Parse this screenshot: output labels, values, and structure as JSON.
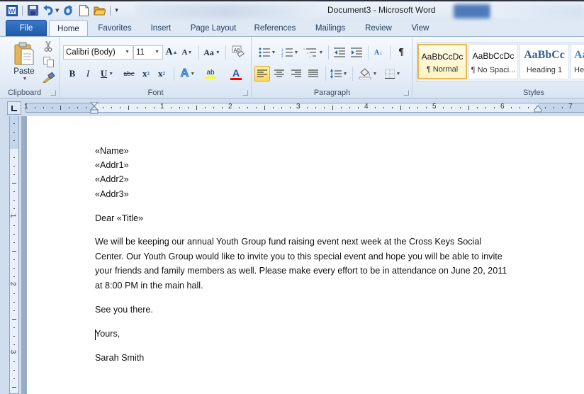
{
  "window": {
    "title": "Document3  -  Microsoft Word"
  },
  "quick_access": {
    "icons": [
      "word-logo-icon",
      "save-icon",
      "undo-icon",
      "redo-icon",
      "new-document-icon",
      "open-folder-icon",
      "customize-qat-icon"
    ]
  },
  "tabs": [
    {
      "label": "File"
    },
    {
      "label": "Home"
    },
    {
      "label": "Favorites"
    },
    {
      "label": "Insert"
    },
    {
      "label": "Page Layout"
    },
    {
      "label": "References"
    },
    {
      "label": "Mailings"
    },
    {
      "label": "Review"
    },
    {
      "label": "View"
    }
  ],
  "ribbon": {
    "clipboard": {
      "label": "Clipboard",
      "paste_label": "Paste"
    },
    "font": {
      "label": "Font",
      "font_name": "Calibri (Body)",
      "font_size": "11",
      "change_case": "Aa",
      "grow_glyph": "A",
      "shrink_glyph": "A",
      "bold": "B",
      "italic": "I",
      "underline": "U",
      "strikethrough": "abc",
      "subscript": "x",
      "superscript": "x",
      "text_effects": "A",
      "highlight": "ab",
      "font_color": "A",
      "highlight_color": "#ffff00",
      "font_color_value": "#ff0000"
    },
    "paragraph": {
      "label": "Paragraph",
      "show_marks": "¶",
      "sort": "A↓"
    },
    "styles": {
      "label": "Styles",
      "items": [
        {
          "sample": "AaBbCcDc",
          "name": "¶ Normal",
          "selected": true
        },
        {
          "sample": "AaBbCcDc",
          "name": "¶ No Spaci...",
          "selected": false
        },
        {
          "sample": "AaBbCc",
          "name": "Heading 1",
          "selected": false
        },
        {
          "sample": "AaBbCc",
          "name": "He",
          "selected": false
        }
      ]
    }
  },
  "ruler": {
    "horizontal_numbers": [
      "1",
      "1",
      "2",
      "3",
      "4",
      "5",
      "6",
      "7"
    ],
    "vertical_numbers": [
      "1",
      "2",
      "3"
    ]
  },
  "document": {
    "address_lines": [
      "«Name»",
      "«Addr1»",
      "«Addr2»",
      "«Addr3»"
    ],
    "salutation": "Dear «Title»",
    "body_lines": [
      "We will be keeping our annual Youth Group fund raising  event next week at the Cross Keys Social",
      "Center. Our Youth Group would like to invite you to this special event and hope you will be able to invite",
      "your friends and family members as well. Please make every effort to be in attendance on June 20, 2011",
      "at 8:00  PM in the main hall."
    ],
    "closing_line": "See you there.",
    "signoff": "Yours,",
    "signature": "Sarah Smith"
  }
}
